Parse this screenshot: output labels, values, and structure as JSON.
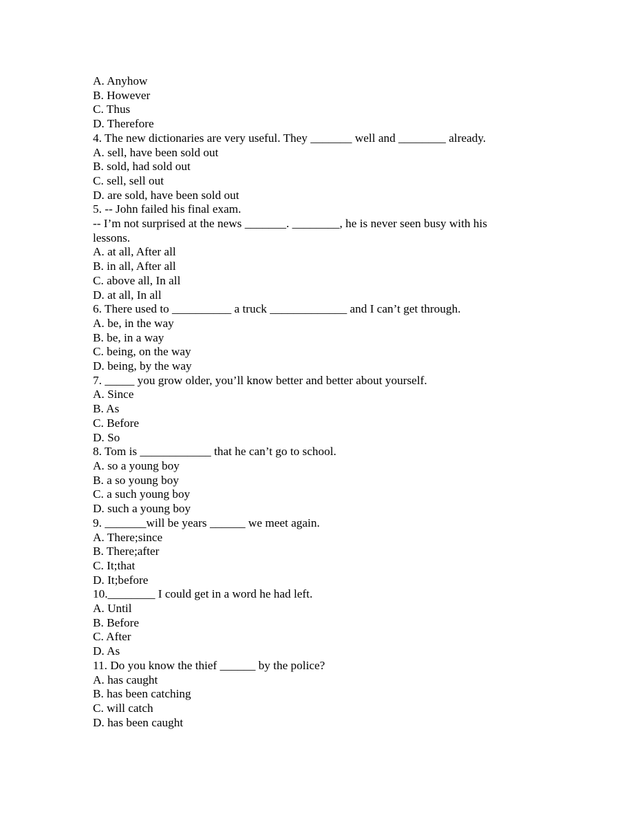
{
  "document": {
    "type": "grammar-multiple-choice-worksheet",
    "page_background": "#ffffff",
    "text_color": "#000000",
    "lines": [
      {
        "id": "l1",
        "kind": "option",
        "text": "A. Anyhow"
      },
      {
        "id": "l2",
        "kind": "option",
        "text": "B. However"
      },
      {
        "id": "l3",
        "kind": "option",
        "text": "C. Thus"
      },
      {
        "id": "l4",
        "kind": "option",
        "text": "D. Therefore"
      },
      {
        "id": "l5",
        "kind": "question",
        "text": "4. The new dictionaries are very useful. They _______ well and ________ already."
      },
      {
        "id": "l6",
        "kind": "option",
        "text": "A. sell, have been sold out"
      },
      {
        "id": "l7",
        "kind": "option",
        "text": "B. sold, had sold out"
      },
      {
        "id": "l8",
        "kind": "option",
        "text": "C. sell, sell out"
      },
      {
        "id": "l9",
        "kind": "option",
        "text": "D. are sold, have been sold out"
      },
      {
        "id": "l10",
        "kind": "question",
        "text": "5. -- John failed his final exam."
      },
      {
        "id": "l11",
        "kind": "question",
        "text": "-- I’m not surprised at the news _______. ________, he is never seen busy with his lessons."
      },
      {
        "id": "l12",
        "kind": "option",
        "text": "A. at all, After all"
      },
      {
        "id": "l13",
        "kind": "option",
        "text": "B. in all, After all"
      },
      {
        "id": "l14",
        "kind": "option",
        "text": "C. above all, In all"
      },
      {
        "id": "l15",
        "kind": "option",
        "text": "D. at all, In all"
      },
      {
        "id": "l16",
        "kind": "question",
        "text": "6. There used to __________ a truck _____________ and I can’t get through."
      },
      {
        "id": "l17",
        "kind": "option",
        "text": "A. be, in the way"
      },
      {
        "id": "l18",
        "kind": "option",
        "text": "B. be, in a way"
      },
      {
        "id": "l19",
        "kind": "option",
        "text": "C. being, on the way"
      },
      {
        "id": "l20",
        "kind": "option",
        "text": "D. being, by the way"
      },
      {
        "id": "l21",
        "kind": "question",
        "text": "7. _____ you grow older, you’ll know better and better about yourself."
      },
      {
        "id": "l22",
        "kind": "option",
        "text": "A. Since"
      },
      {
        "id": "l23",
        "kind": "option",
        "text": "B. As"
      },
      {
        "id": "l24",
        "kind": "option",
        "text": "C. Before"
      },
      {
        "id": "l25",
        "kind": "option",
        "text": "D. So"
      },
      {
        "id": "l26",
        "kind": "question",
        "text": "8. Tom is ____________ that he can’t go to school."
      },
      {
        "id": "l27",
        "kind": "option",
        "text": "A. so a young boy"
      },
      {
        "id": "l28",
        "kind": "option",
        "text": "B. a so young boy"
      },
      {
        "id": "l29",
        "kind": "option",
        "text": "C. a such young boy"
      },
      {
        "id": "l30",
        "kind": "option",
        "text": "D. such a young boy"
      },
      {
        "id": "l31",
        "kind": "question",
        "text": "9. _______will be years ______ we meet again."
      },
      {
        "id": "l32",
        "kind": "option",
        "text": "A. There;since"
      },
      {
        "id": "l33",
        "kind": "option",
        "text": "B. There;after"
      },
      {
        "id": "l34",
        "kind": "option",
        "text": "C. It;that"
      },
      {
        "id": "l35",
        "kind": "option",
        "text": "D. It;before"
      },
      {
        "id": "l36",
        "kind": "question",
        "text": "10.________ I could get in a word he had left."
      },
      {
        "id": "l37",
        "kind": "option",
        "text": "A. Until"
      },
      {
        "id": "l38",
        "kind": "option",
        "text": "B. Before"
      },
      {
        "id": "l39",
        "kind": "option",
        "text": "C. After"
      },
      {
        "id": "l40",
        "kind": "option",
        "text": "D. As"
      },
      {
        "id": "l41",
        "kind": "question",
        "text": "11. Do you know the thief ______ by the police?"
      },
      {
        "id": "l42",
        "kind": "option",
        "text": "A. has caught"
      },
      {
        "id": "l43",
        "kind": "option",
        "text": "B. has been catching"
      },
      {
        "id": "l44",
        "kind": "option",
        "text": "C. will catch"
      },
      {
        "id": "l45",
        "kind": "option",
        "text": "D. has been caught"
      }
    ]
  }
}
